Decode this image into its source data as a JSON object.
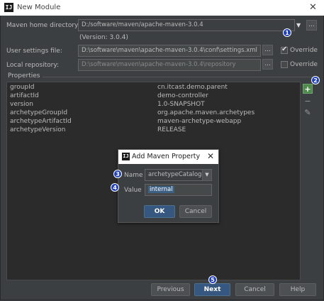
{
  "window": {
    "title": "New Module",
    "app_icon": "IJ"
  },
  "maven_home": {
    "label": "Maven home directory:",
    "value": "D:/software/maven/apache-maven-3.0.4",
    "version": "(Version: 3.0.4)"
  },
  "user_settings": {
    "label": "User settings file:",
    "value": "D:\\software\\maven\\apache-maven-3.0.4\\conf\\settings.xml",
    "override_label": "Override",
    "override_checked": true
  },
  "local_repo": {
    "label": "Local repository:",
    "value": "D:\\software\\maven\\apache-maven-3.0.4\\repository",
    "override_label": "Override",
    "override_checked": false
  },
  "browse_label": "...",
  "properties": {
    "title": "Properties",
    "rows": [
      {
        "key": "groupId",
        "value": "cn.itcast.demo.parent"
      },
      {
        "key": "artifactId",
        "value": "demo-controller"
      },
      {
        "key": "version",
        "value": "1.0-SNAPSHOT"
      },
      {
        "key": "archetypeGroupId",
        "value": "org.apache.maven.archetypes"
      },
      {
        "key": "archetypeArtifactId",
        "value": "maven-archetype-webapp"
      },
      {
        "key": "archetypeVersion",
        "value": "RELEASE"
      }
    ]
  },
  "dialog": {
    "title": "Add Maven Property",
    "name_label": "Name",
    "name_value": "archetypeCatalog",
    "value_label": "Value",
    "value_value": "internal",
    "ok": "OK",
    "cancel": "Cancel"
  },
  "badges": [
    "1",
    "2",
    "3",
    "4",
    "5"
  ],
  "buttons": {
    "previous": "Previous",
    "next": "Next",
    "cancel": "Cancel",
    "help": "Help"
  },
  "colors": {
    "accent": "#365880",
    "badge": "#1f3fb6",
    "add": "#4e8a4b"
  }
}
